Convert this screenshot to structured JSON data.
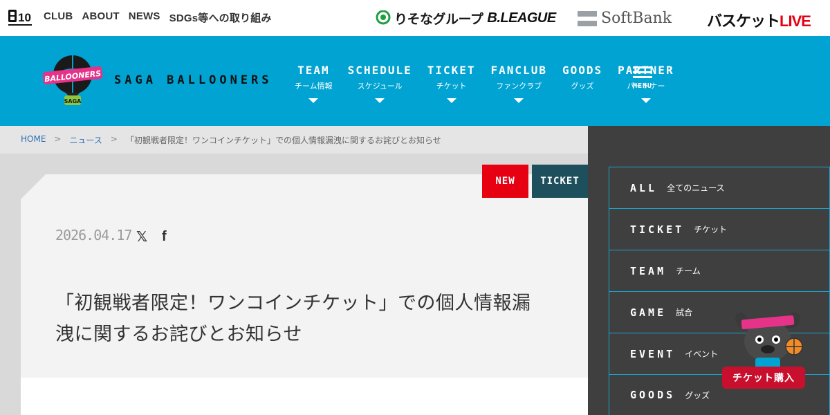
{
  "topbar": {
    "logo_text": "10",
    "nav": [
      "CLUB",
      "ABOUT",
      "NEWS",
      "SDGs等への取り組み"
    ],
    "sponsors": {
      "resona": "りそなグループ",
      "bleague": "B.LEAGUE",
      "softbank": "SoftBank",
      "basket": "バスケット",
      "basket_live": "LIVE"
    }
  },
  "header": {
    "club_name": "SAGA BALLOONERS",
    "logo_top_text": "BALLOONERS",
    "logo_bottom_text": "SAGA",
    "nav": [
      {
        "en": "TEAM",
        "ja": "チーム情報"
      },
      {
        "en": "SCHEDULE",
        "ja": "スケジュール"
      },
      {
        "en": "TICKET",
        "ja": "チケット"
      },
      {
        "en": "FANCLUB",
        "ja": "ファンクラブ"
      },
      {
        "en": "GOODS",
        "ja": "グッズ"
      },
      {
        "en": "PARTNER",
        "ja": "パートナー"
      }
    ],
    "menu_label": "MENU"
  },
  "breadcrumb": {
    "home": "HOME",
    "news": "ニュース",
    "sep": ">",
    "current": "「初観戦者限定！ワンコインチケット」での個人情報漏洩に関するお詫びとお知らせ"
  },
  "article": {
    "tag_new": "NEW",
    "tag_category": "TICKET",
    "date": "2026.04.17",
    "share_x": "𝕏",
    "share_fb": "f",
    "title": "「初観戦者限定！ワンコインチケット」での個人情報漏洩に関するお詫びとお知らせ"
  },
  "sidebar": {
    "categories": [
      {
        "en": "ALL",
        "ja": "全てのニュース"
      },
      {
        "en": "TICKET",
        "ja": "チケット"
      },
      {
        "en": "TEAM",
        "ja": "チーム"
      },
      {
        "en": "GAME",
        "ja": "試合"
      },
      {
        "en": "EVENT",
        "ja": "イベント"
      },
      {
        "en": "GOODS",
        "ja": "グッズ"
      }
    ],
    "ticket_button": "チケット購入"
  }
}
